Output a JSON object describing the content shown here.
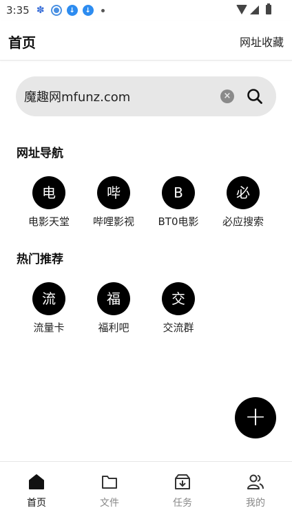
{
  "status_bar": {
    "time": "3:35"
  },
  "header": {
    "title": "首页",
    "action": "网址收藏"
  },
  "search": {
    "value": "魔趣网mfunz.com"
  },
  "sections": {
    "nav": {
      "title": "网址导航",
      "items": [
        {
          "glyph": "电",
          "label": "电影天堂"
        },
        {
          "glyph": "哔",
          "label": "哔哩影视"
        },
        {
          "glyph": "B",
          "label": "BT0电影"
        },
        {
          "glyph": "必",
          "label": "必应搜索"
        }
      ]
    },
    "hot": {
      "title": "热门推荐",
      "items": [
        {
          "glyph": "流",
          "label": "流量卡"
        },
        {
          "glyph": "福",
          "label": "福利吧"
        },
        {
          "glyph": "交",
          "label": "交流群"
        }
      ]
    }
  },
  "fab": {
    "glyph": "+"
  },
  "bottom_nav": [
    {
      "label": "首页",
      "icon": "home-icon",
      "active": true
    },
    {
      "label": "文件",
      "icon": "folder-icon",
      "active": false
    },
    {
      "label": "任务",
      "icon": "download-box-icon",
      "active": false
    },
    {
      "label": "我的",
      "icon": "users-icon",
      "active": false
    }
  ]
}
